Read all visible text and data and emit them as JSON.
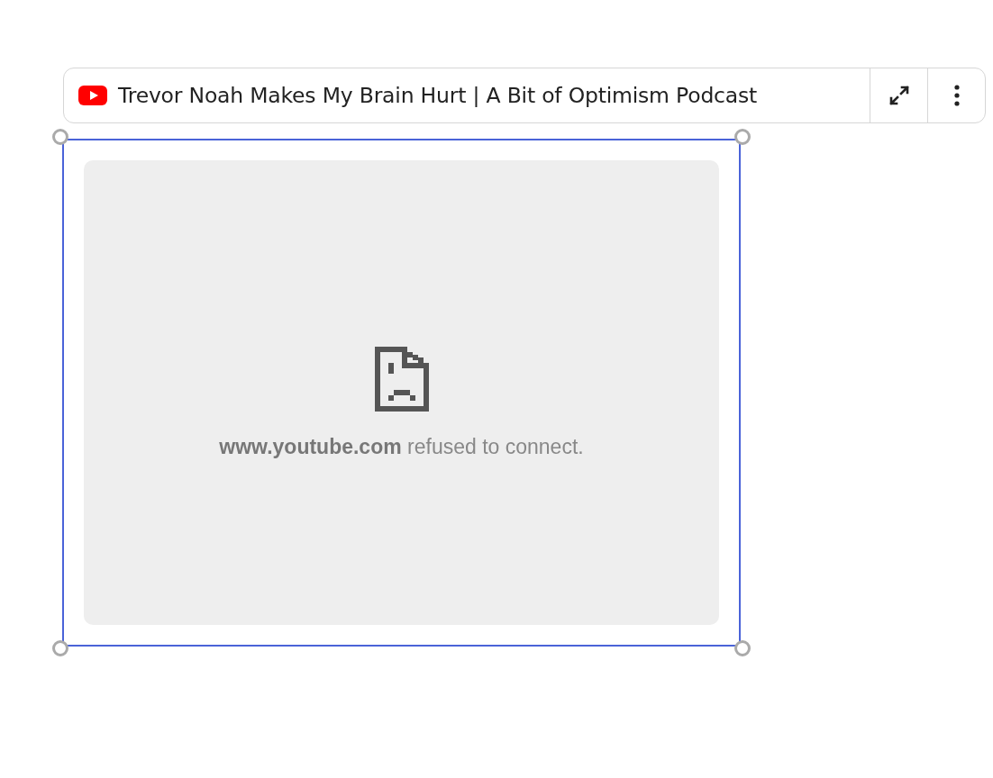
{
  "embed_toolbar": {
    "title": "Trevor Noah Makes My Brain Hurt | A Bit of Optimism Podcast"
  },
  "embed": {
    "selected": true,
    "error_message": "**www.youtube.com** refused to connect."
  }
}
